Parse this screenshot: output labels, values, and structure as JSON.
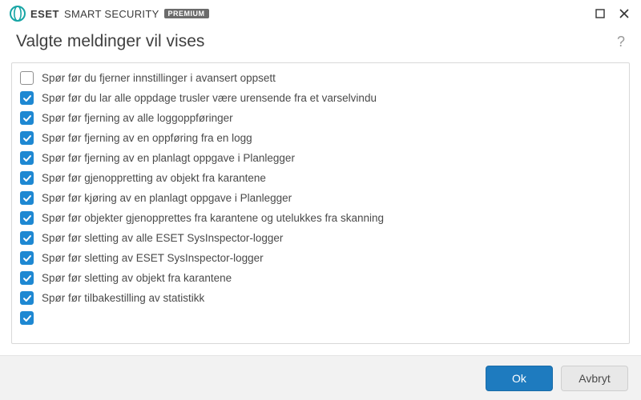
{
  "brand": {
    "eset": "ESET",
    "product": "SMART SECURITY",
    "edition": "PREMIUM"
  },
  "page_title": "Valgte meldinger vil vises",
  "items": [
    {
      "checked": false,
      "label": "Spør før du fjerner innstillinger i avansert oppsett"
    },
    {
      "checked": true,
      "label": "Spør før du lar alle oppdage trusler være urensende fra et varselvindu"
    },
    {
      "checked": true,
      "label": "Spør før fjerning av alle loggoppføringer"
    },
    {
      "checked": true,
      "label": "Spør før fjerning av en oppføring fra en logg"
    },
    {
      "checked": true,
      "label": "Spør før fjerning av en planlagt oppgave i Planlegger"
    },
    {
      "checked": true,
      "label": "Spør før gjenoppretting av objekt fra karantene"
    },
    {
      "checked": true,
      "label": "Spør før kjøring av en planlagt oppgave i Planlegger"
    },
    {
      "checked": true,
      "label": "Spør før objekter gjenopprettes fra karantene og utelukkes fra skanning"
    },
    {
      "checked": true,
      "label": "Spør før sletting av alle ESET SysInspector-logger"
    },
    {
      "checked": true,
      "label": "Spør før sletting av ESET SysInspector-logger"
    },
    {
      "checked": true,
      "label": "Spør før sletting av objekt fra karantene"
    },
    {
      "checked": true,
      "label": "Spør før tilbakestilling av statistikk"
    },
    {
      "checked": true,
      "label": ""
    }
  ],
  "buttons": {
    "ok": "Ok",
    "cancel": "Avbryt"
  }
}
